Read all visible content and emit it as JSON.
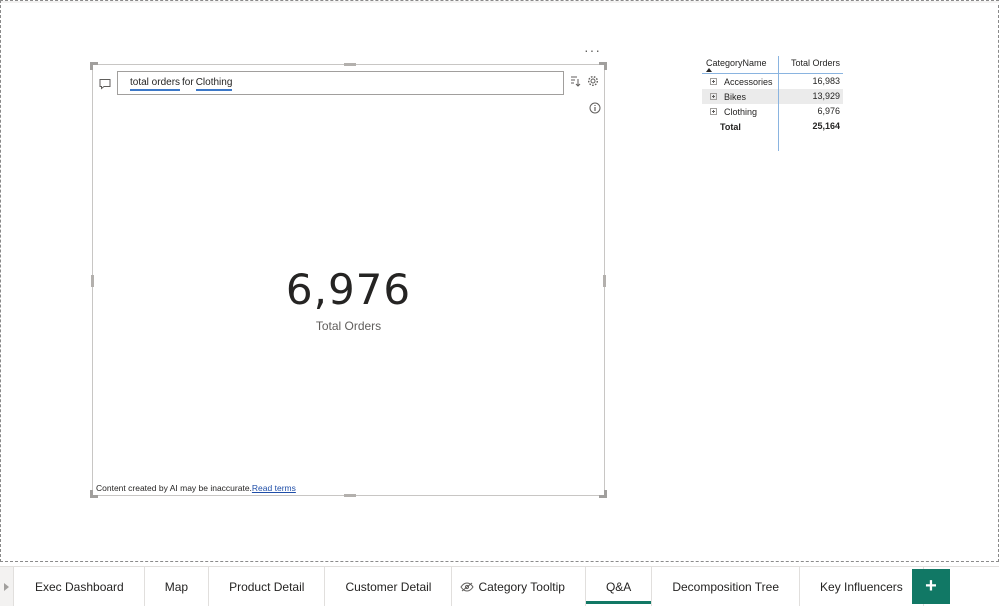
{
  "qna": {
    "question_term_1": "total orders",
    "question_word": "for",
    "question_term_2": "Clothing",
    "result_value": "6,976",
    "result_label": "Total Orders",
    "disclaimer_text": "Content created by AI may be inaccurate.",
    "disclaimer_link": "Read terms",
    "more_options": "···"
  },
  "matrix": {
    "headers": [
      "CategoryName",
      "Total Orders"
    ],
    "rows": [
      {
        "category": "Accessories",
        "orders": "16,983"
      },
      {
        "category": "Bikes",
        "orders": "13,929"
      },
      {
        "category": "Clothing",
        "orders": "6,976"
      }
    ],
    "total": {
      "label": "Total",
      "orders": "25,164"
    }
  },
  "tabs": [
    {
      "label": "Exec Dashboard"
    },
    {
      "label": "Map"
    },
    {
      "label": "Product Detail"
    },
    {
      "label": "Customer Detail"
    },
    {
      "label": "Category Tooltip",
      "icon": "hidden-eye-icon"
    },
    {
      "label": "Q&A",
      "active": true
    },
    {
      "label": "Decomposition Tree"
    },
    {
      "label": "Key Influencers"
    }
  ],
  "add_tab_label": "+",
  "colors": {
    "accent": "#117865",
    "underline": "#3c78c8",
    "link": "#1f4ea8"
  }
}
